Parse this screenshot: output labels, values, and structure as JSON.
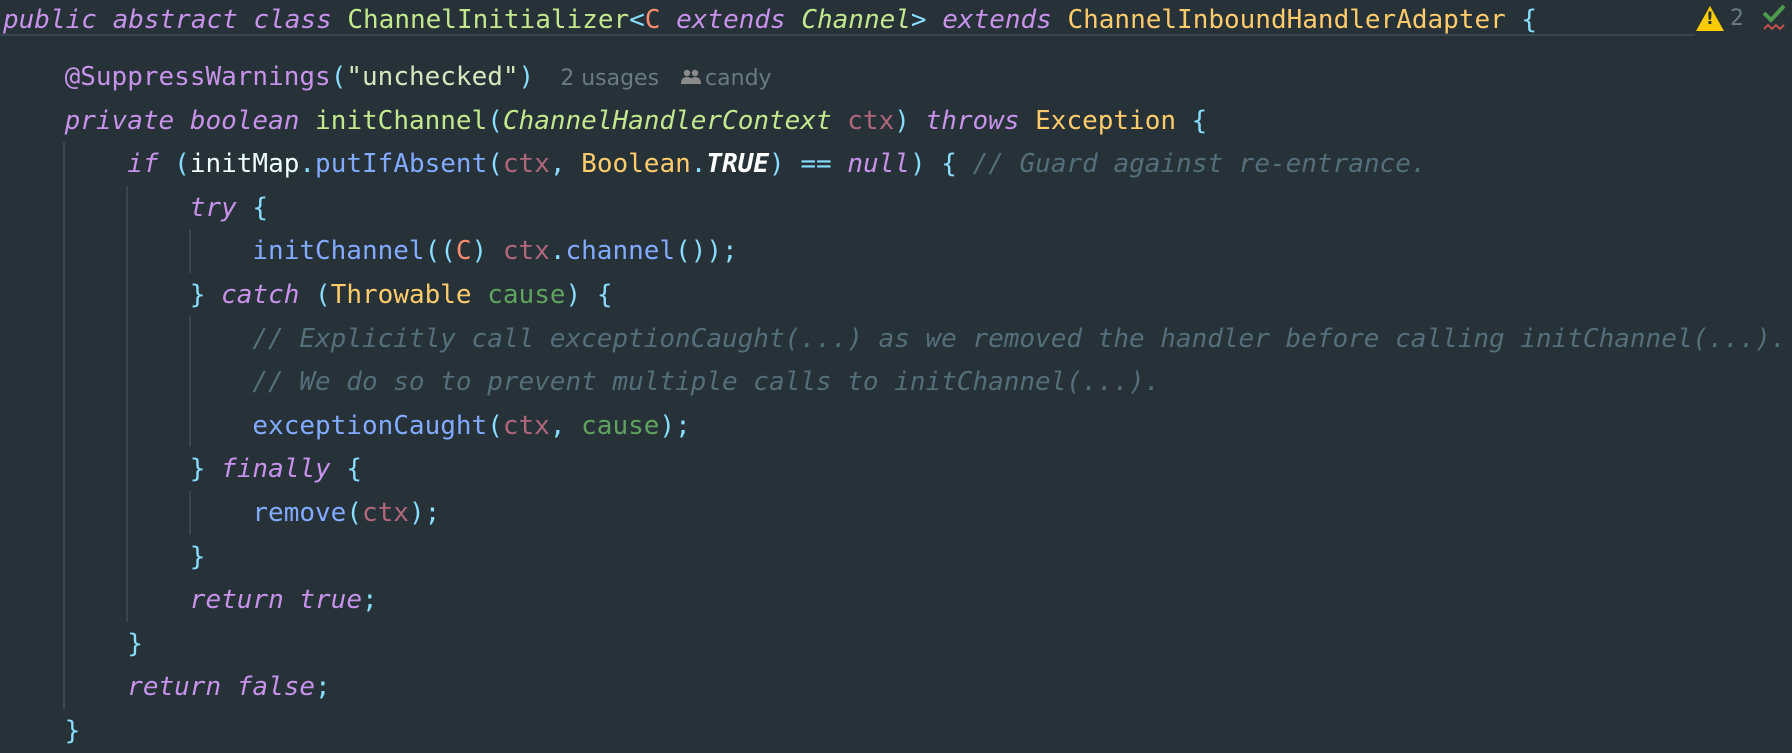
{
  "sticky_header": {
    "tokens": [
      {
        "t": "public abstract class ",
        "c": "kw"
      },
      {
        "t": "ChannelInitializer",
        "c": "cls"
      },
      {
        "t": "<",
        "c": "p"
      },
      {
        "t": "C",
        "c": "tp"
      },
      {
        "t": " extends ",
        "c": "kw"
      },
      {
        "t": "Channel",
        "c": "clsi"
      },
      {
        "t": ">",
        "c": "p"
      },
      {
        "t": " extends ",
        "c": "kw"
      },
      {
        "t": "ChannelInboundHandlerAdapter",
        "c": "type"
      },
      {
        "t": " {",
        "c": "p"
      }
    ]
  },
  "inspections": {
    "warning_icon": "warning-triangle-icon",
    "warning_count": "2",
    "check_icon": "check-icon",
    "colors": {
      "warning": "#FFCC00",
      "check": "#4E9A4E"
    }
  },
  "inlay": {
    "usages": "2 usages",
    "author_icon": "people-icon",
    "author": "candy"
  },
  "code": {
    "lines": [
      {
        "indent": 1,
        "tokens": [
          {
            "t": "@SuppressWarnings",
            "c": "ann"
          },
          {
            "t": "(",
            "c": "p"
          },
          {
            "t": "\"unchecked\"",
            "c": "str"
          },
          {
            "t": ")",
            "c": "p"
          }
        ]
      },
      {
        "indent": 1,
        "tokens": [
          {
            "t": "private boolean ",
            "c": "kw"
          },
          {
            "t": "initChannel",
            "c": "cls"
          },
          {
            "t": "(",
            "c": "p"
          },
          {
            "t": "ChannelHandlerContext",
            "c": "clsi"
          },
          {
            "t": " ",
            "c": "pl"
          },
          {
            "t": "ctx",
            "c": "param"
          },
          {
            "t": ") ",
            "c": "p"
          },
          {
            "t": "throws ",
            "c": "kw"
          },
          {
            "t": "Exception",
            "c": "type"
          },
          {
            "t": " {",
            "c": "p"
          }
        ]
      },
      {
        "indent": 2,
        "tokens": [
          {
            "t": "if ",
            "c": "kw"
          },
          {
            "t": "(",
            "c": "p"
          },
          {
            "t": "initMap",
            "c": "pl"
          },
          {
            "t": ".",
            "c": "p"
          },
          {
            "t": "putIfAbsent",
            "c": "fn"
          },
          {
            "t": "(",
            "c": "p"
          },
          {
            "t": "ctx",
            "c": "param"
          },
          {
            "t": ", ",
            "c": "p"
          },
          {
            "t": "Boolean",
            "c": "type"
          },
          {
            "t": ".",
            "c": "p"
          },
          {
            "t": "TRUE",
            "c": "const"
          },
          {
            "t": ") == ",
            "c": "p"
          },
          {
            "t": "null",
            "c": "kw"
          },
          {
            "t": ") { ",
            "c": "p"
          },
          {
            "t": "// Guard against re-entrance.",
            "c": "cm"
          }
        ]
      },
      {
        "indent": 3,
        "tokens": [
          {
            "t": "try",
            "c": "kw"
          },
          {
            "t": " {",
            "c": "p"
          }
        ]
      },
      {
        "indent": 4,
        "tokens": [
          {
            "t": "initChannel",
            "c": "fn"
          },
          {
            "t": "((",
            "c": "p"
          },
          {
            "t": "C",
            "c": "tp"
          },
          {
            "t": ") ",
            "c": "p"
          },
          {
            "t": "ctx",
            "c": "param"
          },
          {
            "t": ".",
            "c": "p"
          },
          {
            "t": "channel",
            "c": "fn"
          },
          {
            "t": "());",
            "c": "p"
          }
        ]
      },
      {
        "indent": 3,
        "tokens": [
          {
            "t": "} ",
            "c": "p"
          },
          {
            "t": "catch",
            "c": "kw"
          },
          {
            "t": " (",
            "c": "p"
          },
          {
            "t": "Throwable",
            "c": "type"
          },
          {
            "t": " ",
            "c": "pl"
          },
          {
            "t": "cause",
            "c": "loc"
          },
          {
            "t": ") {",
            "c": "p"
          }
        ]
      },
      {
        "indent": 4,
        "tokens": [
          {
            "t": "// Explicitly call exceptionCaught(...) as we removed the handler before calling initChannel(...).",
            "c": "cm"
          }
        ]
      },
      {
        "indent": 4,
        "tokens": [
          {
            "t": "// We do so to prevent multiple calls to initChannel(...).",
            "c": "cm"
          }
        ]
      },
      {
        "indent": 4,
        "tokens": [
          {
            "t": "exceptionCaught",
            "c": "fn"
          },
          {
            "t": "(",
            "c": "p"
          },
          {
            "t": "ctx",
            "c": "param"
          },
          {
            "t": ", ",
            "c": "p"
          },
          {
            "t": "cause",
            "c": "loc"
          },
          {
            "t": ");",
            "c": "p"
          }
        ]
      },
      {
        "indent": 3,
        "tokens": [
          {
            "t": "} ",
            "c": "p"
          },
          {
            "t": "finally",
            "c": "kw"
          },
          {
            "t": " {",
            "c": "p"
          }
        ]
      },
      {
        "indent": 4,
        "tokens": [
          {
            "t": "remove",
            "c": "fn"
          },
          {
            "t": "(",
            "c": "p"
          },
          {
            "t": "ctx",
            "c": "param"
          },
          {
            "t": ");",
            "c": "p"
          }
        ]
      },
      {
        "indent": 3,
        "tokens": [
          {
            "t": "}",
            "c": "p"
          }
        ]
      },
      {
        "indent": 3,
        "tokens": [
          {
            "t": "return true",
            "c": "kw"
          },
          {
            "t": ";",
            "c": "p"
          }
        ]
      },
      {
        "indent": 2,
        "tokens": [
          {
            "t": "}",
            "c": "p"
          }
        ]
      },
      {
        "indent": 2,
        "tokens": [
          {
            "t": "return false",
            "c": "kw"
          },
          {
            "t": ";",
            "c": "p"
          }
        ]
      },
      {
        "indent": 1,
        "tokens": [
          {
            "t": "}",
            "c": "p"
          }
        ]
      }
    ]
  }
}
